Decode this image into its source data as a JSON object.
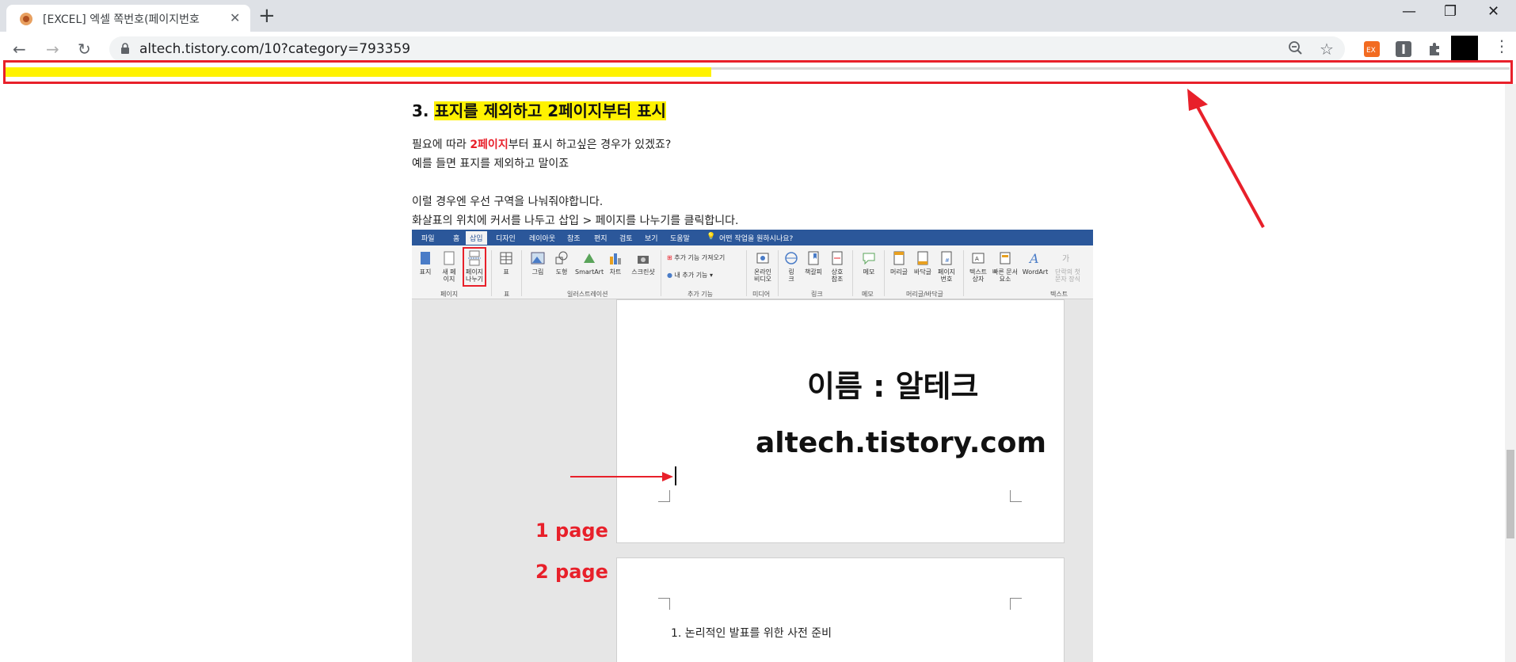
{
  "browser": {
    "tab_title": "[EXCEL] 엑셀 쪽번호(페이지번호",
    "url": "altech.tistory.com/10?category=793359",
    "progress": 0.47
  },
  "post": {
    "heading_number": "3. ",
    "heading_text": "표지를 제외하고 2페이지부터 표시",
    "p1_pre": "필요에 따라 ",
    "p1_red": "2페이지",
    "p1_post": "부터 표시 하고싶은 경우가 있겠죠?",
    "p2": "예를 들면 표지를 제외하고 말이죠",
    "p3": "이럴 경우엔 우선 구역을 나눠줘야합니다.",
    "p4": "화살표의 위치에 커서를 나두고 삽입 > 페이지를 나누기를 클릭합니다."
  },
  "word": {
    "tabs": [
      "파일",
      "홈",
      "삽입",
      "디자인",
      "레이아웃",
      "참조",
      "편지",
      "검토",
      "보기",
      "도움말"
    ],
    "tell_me": "어떤 작업을 원하시나요?",
    "buttons": {
      "cover": "표지",
      "blank": "새 페\n이지",
      "pagebreak": "페이지\n나누기",
      "table": "표",
      "picture": "그림",
      "shapes": "도형",
      "smartart": "SmartArt",
      "chart": "차트",
      "screenshot": "스크린샷",
      "addin_get": "추가 기능 가져오기",
      "addin_my": "내 추가 기능",
      "video": "온라인\n비디오",
      "link": "링\n크",
      "bookmark": "책갈피",
      "crossref": "상호\n참조",
      "comment": "메모",
      "header": "머리글",
      "footer": "바닥글",
      "pagenum": "페이지\n번호",
      "textbox": "텍스트\n상자",
      "quickparts": "빠른 문서\n요소",
      "wordart": "WordArt",
      "dropcap": "단락의 첫\n문자 장식"
    },
    "groups": [
      "페이지",
      "표",
      "일러스트레이션",
      "추가 기능",
      "미디어",
      "링크",
      "메모",
      "머리글/바닥글",
      "텍스트"
    ],
    "page1_line1": "이름 : 알테크",
    "page1_line2": "altech.tistory.com",
    "label_page1": "1 page",
    "label_page2": "2 page",
    "page2_list": "1.  논리적인  발표를  위한  사전  준비"
  },
  "colors": {
    "accent_red": "#e8202a",
    "highlight_yellow": "#fff200",
    "word_blue": "#2b579a"
  }
}
